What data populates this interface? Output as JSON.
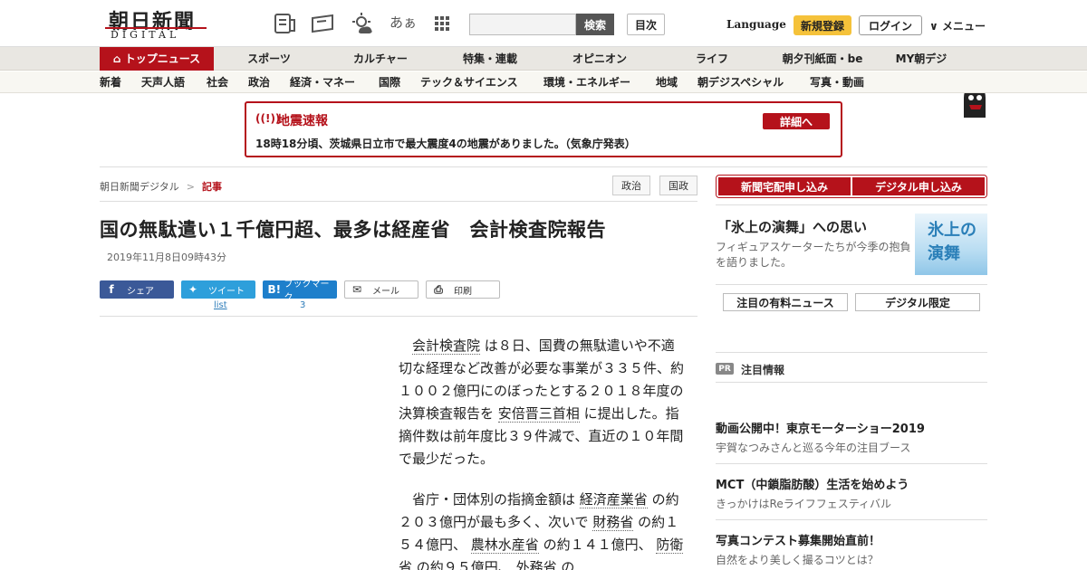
{
  "header": {
    "logo": "朝日新聞",
    "logo_sub": "DIGITAL",
    "search_button": "検索",
    "toc_button": "目次",
    "language": "Language",
    "register": "新規登録",
    "login": "ログイン",
    "menu": "メニュー",
    "font_size_icon": "あぁ"
  },
  "nav": {
    "main": [
      "トップニュース",
      "スポーツ",
      "カルチャー",
      "特集・連載",
      "オピニオン",
      "ライフ",
      "朝夕刊紙面・be",
      "MY朝デジ"
    ],
    "sub": [
      "新着",
      "天声人語",
      "社会",
      "政治",
      "経済・マネー",
      "国際",
      "テック＆サイエンス",
      "環境・エネルギー",
      "地域",
      "朝デジスペシャル",
      "写真・動画"
    ]
  },
  "alert": {
    "title": "地震速報",
    "detail_button": "詳細へ",
    "text": "18時18分頃、茨城県日立市で最大震度4の地震がありました。（気象庁発表）"
  },
  "article": {
    "breadcrumb": [
      "朝日新聞デジタル",
      "記事"
    ],
    "tags": [
      "政治",
      "国政"
    ],
    "headline": "国の無駄遣い１千億円超、最多は経産省　会計検査院報告",
    "date": "2019年11月8日09時43分",
    "share": {
      "facebook": "シェア",
      "twitter": "ツイート",
      "hatena": "ブックマーク",
      "mail": "メール",
      "print": "印刷",
      "twitter_count": "list",
      "hatena_count": "3"
    },
    "p1": {
      "link1": "会計検査院",
      "t1": " は８日、国費の無駄遣いや不適切な経理など改善が必要な事業が３３５件、約１００２億円にのぼったとする２０１８年度の決算検査報告を ",
      "link2": "安倍晋三首相",
      "t2": " に提出した。指摘件数は前年度比３９件減で、直近の１０年間で最少だった。"
    },
    "p2": {
      "t1": "省庁・団体別の指摘金額は ",
      "link1": "経済産業省",
      "t2": " の約２０３億円が最も多く、次いで ",
      "link2": "財務省",
      "t3": " の約１５４億円、 ",
      "link3": "農林水産省",
      "t4": " の約１４１億円、 ",
      "link4": "防衛省",
      "t5": " の約９５億円、 ",
      "link5": "外務省",
      "t6": " の"
    }
  },
  "sidebar": {
    "subscribe_paper": "新聞宅配申し込み",
    "subscribe_digital": "デジタル申し込み",
    "promo_title": "「氷上の演舞」への思い",
    "promo_desc": "フィギュアスケーターたちが今季の抱負を語りました。",
    "promo_image_text": "氷上の演舞",
    "paid_news": "注目の有料ニュース",
    "digital_only": "デジタル限定",
    "pr_badge": "PR",
    "pr_title": "注目情報",
    "ads": [
      {
        "title": "動画公開中！東京モーターショー2019",
        "sub": "宇賀なつみさんと巡る今年の注目ブース"
      },
      {
        "title": "MCT（中鎖脂肪酸）生活を始めよう",
        "sub": "きっかけはReライフフェスティバル"
      },
      {
        "title": "写真コンテスト募集開始直前！",
        "sub": "自然をより美しく撮るコツとは？"
      }
    ]
  },
  "colors": {
    "brand_red": "#b5121b",
    "register_yellow": "#f5c23a",
    "facebook": "#3b5998",
    "twitter": "#2e9fdb"
  }
}
